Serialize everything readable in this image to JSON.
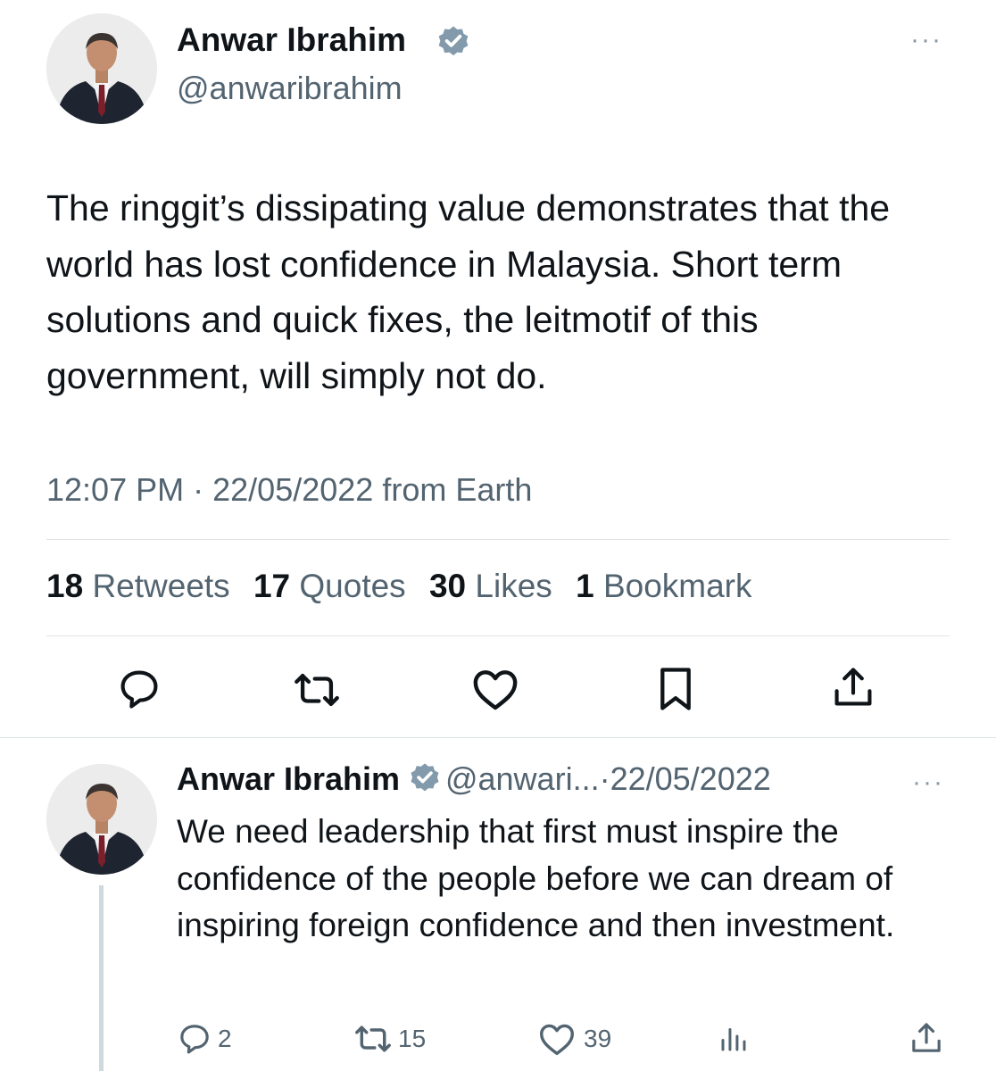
{
  "tweet": {
    "author_name": "Anwar Ibrahim",
    "author_handle": "@anwaribrahim",
    "verified": true,
    "text": "The ringgit’s dissipating value demonstrates that the world has lost confidence in Malaysia. Short term solutions and quick fixes, the leitmotif of this government, will simply not do.",
    "time": "12:07 PM",
    "separator": "·",
    "date": "22/05/2022",
    "source": "from Earth",
    "stats": {
      "retweets_count": "18",
      "retweets_label": "Retweets",
      "quotes_count": "17",
      "quotes_label": "Quotes",
      "likes_count": "30",
      "likes_label": "Likes",
      "bookmarks_count": "1",
      "bookmarks_label": "Bookmark"
    },
    "more": "···"
  },
  "reply": {
    "author_name": "Anwar Ibrahim",
    "author_handle": "@anwari...",
    "separator": "·",
    "date": "22/05/2022",
    "more": "···",
    "text": "We need leadership that first must inspire the confidence of the people before we can dream of inspiring foreign confidence and then investment.",
    "replies_count": "2",
    "retweets_count": "15",
    "likes_count": "39"
  },
  "icons": {
    "verified": "verified-badge-icon",
    "reply": "comment-bubble-icon",
    "retweet": "retweet-arrows-icon",
    "like": "heart-icon",
    "bookmark": "bookmark-icon",
    "share": "share-upload-icon",
    "views": "views-bar-chart-icon"
  },
  "colors": {
    "verified_badge": "#829aab",
    "secondary_text": "#536471",
    "divider": "#dfe3e6"
  }
}
